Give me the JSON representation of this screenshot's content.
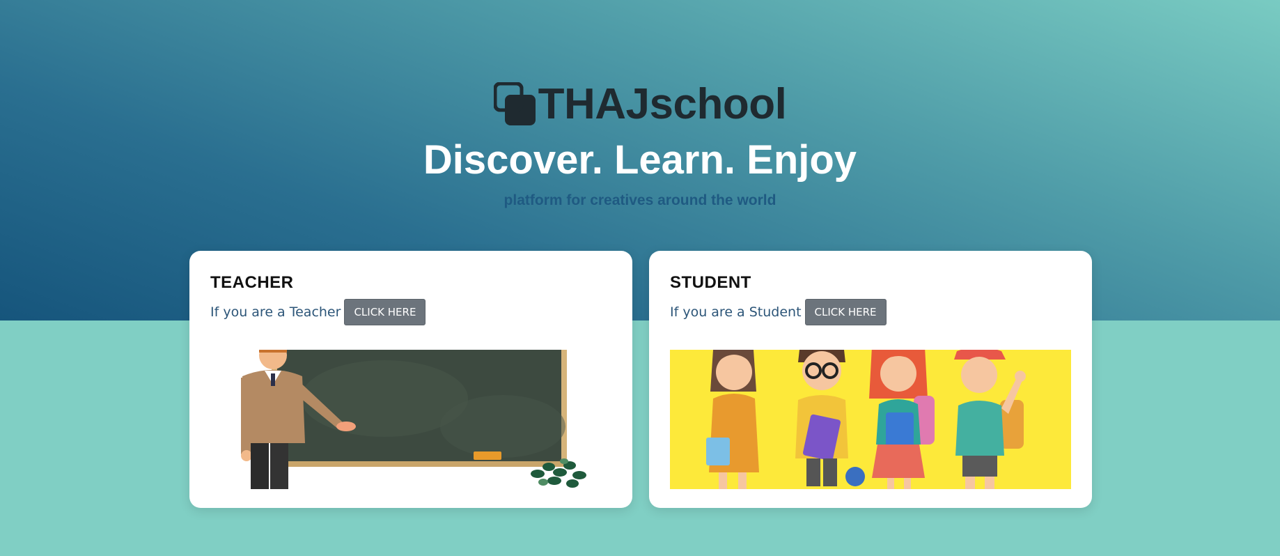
{
  "brand": {
    "name": "THAJschool",
    "logo_icon": "overlapping-squares-icon"
  },
  "hero": {
    "headline": "Discover. Learn. Enjoy",
    "tagline": "platform for creatives around the world"
  },
  "cards": [
    {
      "title": "TEACHER",
      "text": "If you are a Teacher",
      "button_label": "CLICK HERE",
      "image": "teacher-at-blackboard-illustration"
    },
    {
      "title": "STUDENT",
      "text": "If you are a Student",
      "button_label": "CLICK HERE",
      "image": "group-of-students-illustration"
    }
  ],
  "colors": {
    "hero_dark": "#16557c",
    "hero_light": "#79cbc2",
    "page_bg": "#80cfc4",
    "tagline": "#1f5a82",
    "button_bg": "#6c747c"
  }
}
